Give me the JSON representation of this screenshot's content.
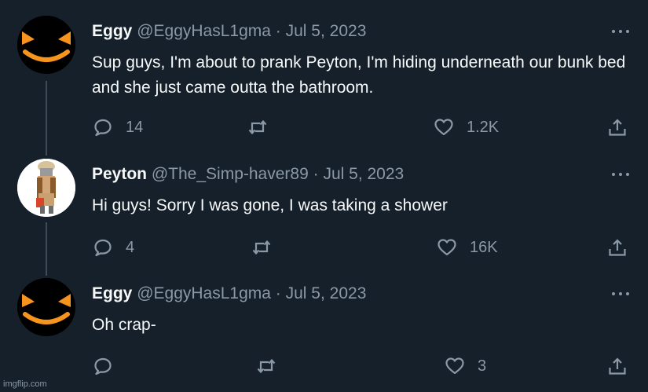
{
  "tweets": [
    {
      "name": "Eggy",
      "handle": "@EggyHasL1gma",
      "separator": "·",
      "date": "Jul 5, 2023",
      "text": "Sup guys, I'm about to prank Peyton, I'm hiding underneath our bunk bed and she just came outta the bathroom.",
      "avatar": "eggy-avatar",
      "reply_count": "14",
      "retweet_count": "",
      "like_count": "1.2K"
    },
    {
      "name": "Peyton",
      "handle": "@The_Simp-haver89",
      "separator": "·",
      "date": "Jul 5, 2023",
      "text": "Hi guys! Sorry I was gone, I was taking a shower",
      "avatar": "peyton-avatar",
      "reply_count": "4",
      "retweet_count": "",
      "like_count": "16K"
    },
    {
      "name": "Eggy",
      "handle": "@EggyHasL1gma",
      "separator": "·",
      "date": "Jul 5, 2023",
      "text": "Oh crap-",
      "avatar": "eggy-avatar",
      "reply_count": "",
      "retweet_count": "",
      "like_count": "3"
    }
  ],
  "icons": {
    "reply": "reply-icon",
    "retweet": "retweet-icon",
    "like": "heart-icon",
    "share": "share-icon",
    "more": "more-icon"
  },
  "colors": {
    "background": "#15202b",
    "text": "#f7f9f9",
    "muted": "#8b98a5",
    "thread_line": "#3e4a56"
  },
  "watermark": "imgflip.com"
}
